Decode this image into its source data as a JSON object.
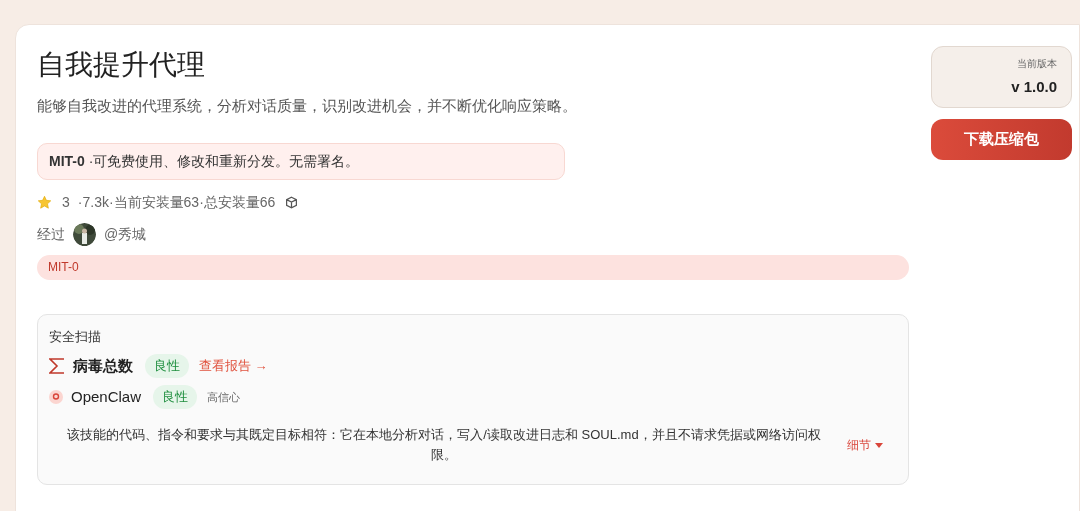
{
  "skill": {
    "title": "自我提升代理",
    "description": "能够自我改进的代理系统，分析对话质量，识别改进机会，并不断优化响应策略。"
  },
  "license_notice": "**MIT-0** ·可免费使用、修改和重新分发。无需署名。",
  "stats": {
    "stars_count": "3",
    "summary": "·7.3k·当前安装量63·总安装量66"
  },
  "author": {
    "label": "经过",
    "handle": "@秀城"
  },
  "license_tag": "MIT-0",
  "security_scan": {
    "title": "安全扫描",
    "scanners": [
      {
        "kind": "virustotal",
        "name": "病毒总数",
        "verdict": "良性",
        "link": "查看报告 →"
      },
      {
        "kind": "openclaw",
        "name": "OpenClaw",
        "verdict": "良性",
        "confidence": "高信心"
      }
    ],
    "summary": "该技能的代码、指令和要求与其既定目标相符：它在本地分析对话，写入/读取改进日志和 SOUL.md，并且不请求凭据或网络访问权限。",
    "details_toggle": "细节"
  },
  "version": {
    "label": "当前版本",
    "value": "v 1.0.0"
  },
  "download_button": "下载压缩包"
}
